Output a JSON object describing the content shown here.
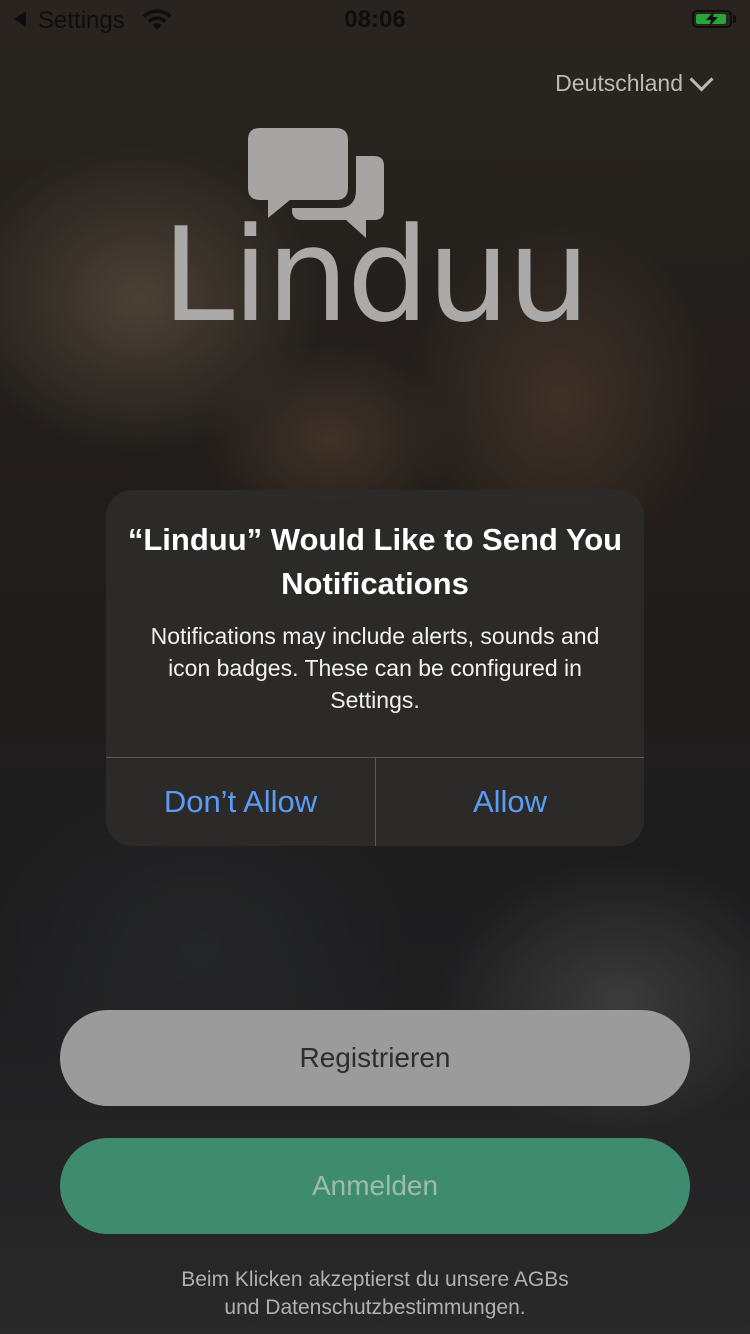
{
  "status_bar": {
    "back_label": "Settings",
    "time": "08:06",
    "battery_charging": true
  },
  "header": {
    "country": "Deutschland"
  },
  "logo": {
    "text": "Linduu",
    "icon": "chat-bubbles-icon"
  },
  "dialog": {
    "title": "“Linduu” Would Like to Send You Notifications",
    "message": "Notifications may include alerts, sounds and icon badges. These can be configured in Settings.",
    "deny_label": "Don’t Allow",
    "allow_label": "Allow",
    "button_color": "#5a9cf6"
  },
  "actions": {
    "register_label": "Registrieren",
    "login_label": "Anmelden",
    "login_color": "#3f8b6f"
  },
  "footer": {
    "legal_line1": "Beim Klicken akzeptierst du unsere AGBs",
    "legal_line2": "und Datenschutzbestimmungen."
  }
}
